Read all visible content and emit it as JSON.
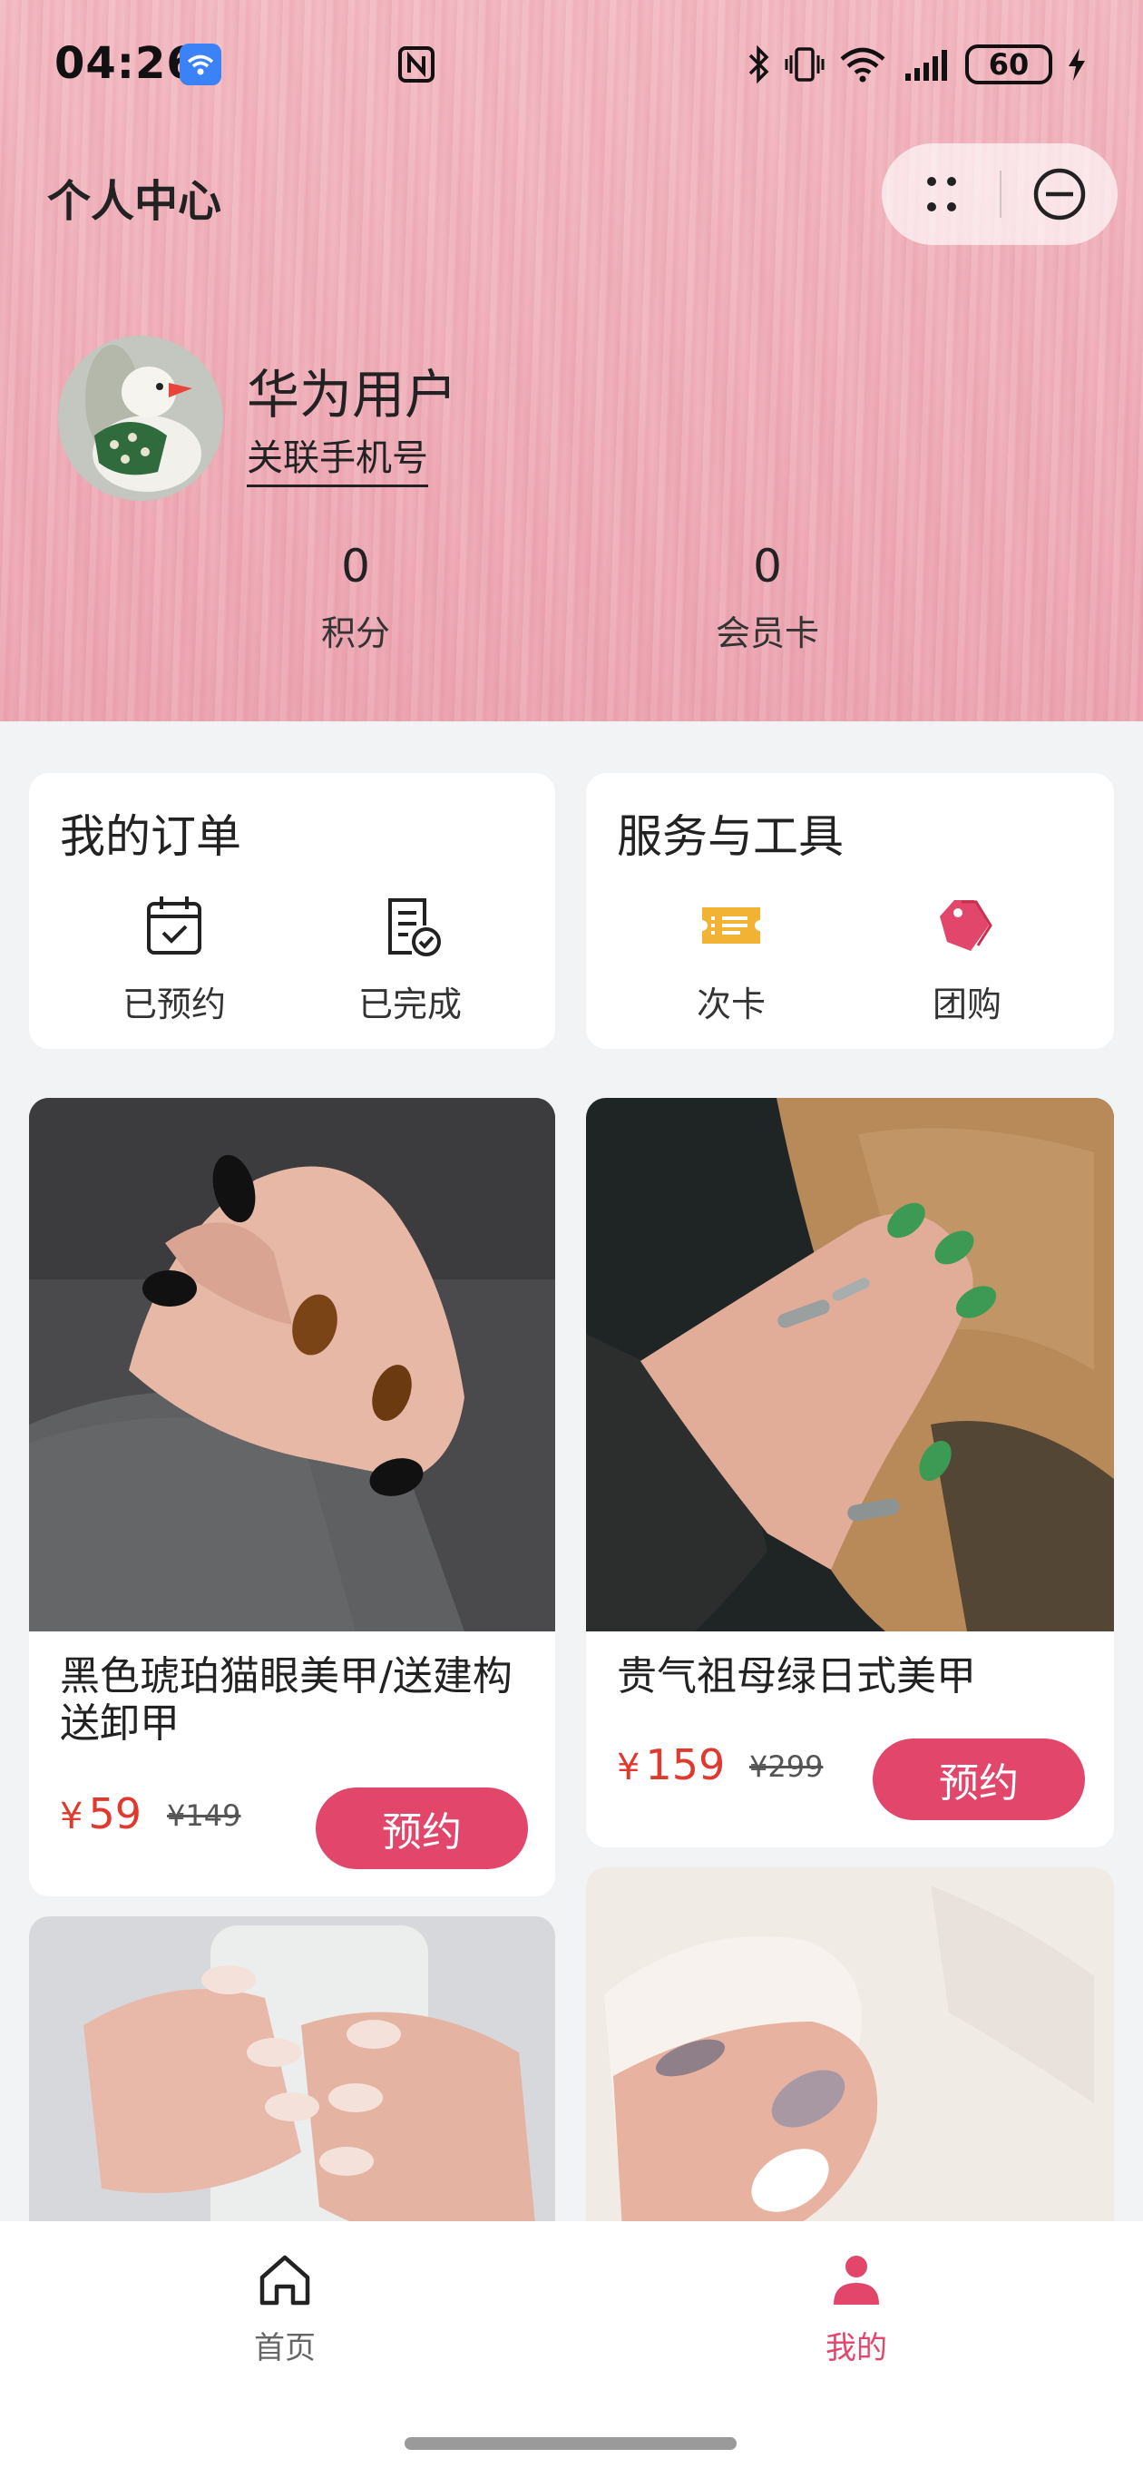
{
  "status_bar": {
    "time": "04:26",
    "battery": "60"
  },
  "header": {
    "title": "个人中心"
  },
  "profile": {
    "username": "华为用户",
    "link_phone": "关联手机号"
  },
  "stats": [
    {
      "value": "0",
      "label": "积分"
    },
    {
      "value": "0",
      "label": "会员卡"
    }
  ],
  "orders": {
    "title": "我的订单",
    "items": [
      {
        "label": "已预约",
        "icon": "calendar-check-icon"
      },
      {
        "label": "已完成",
        "icon": "document-check-icon"
      }
    ]
  },
  "services": {
    "title": "服务与工具",
    "items": [
      {
        "label": "次卡",
        "icon": "ticket-icon"
      },
      {
        "label": "团购",
        "icon": "tag-icon"
      }
    ]
  },
  "products": [
    {
      "name": "黑色琥珀猫眼美甲/送建构送卸甲",
      "currency": "¥",
      "price": "59",
      "old_price": "¥149",
      "button": "预约"
    },
    {
      "name": "贵气祖母绿日式美甲",
      "currency": "¥",
      "price": "159",
      "old_price": "¥299",
      "button": "预约"
    }
  ],
  "nav": [
    {
      "label": "首页",
      "icon": "home-icon"
    },
    {
      "label": "我的",
      "icon": "person-icon"
    }
  ],
  "colors": {
    "accent": "#e2466a",
    "price": "#e0392f",
    "ticket": "#f2b335"
  }
}
